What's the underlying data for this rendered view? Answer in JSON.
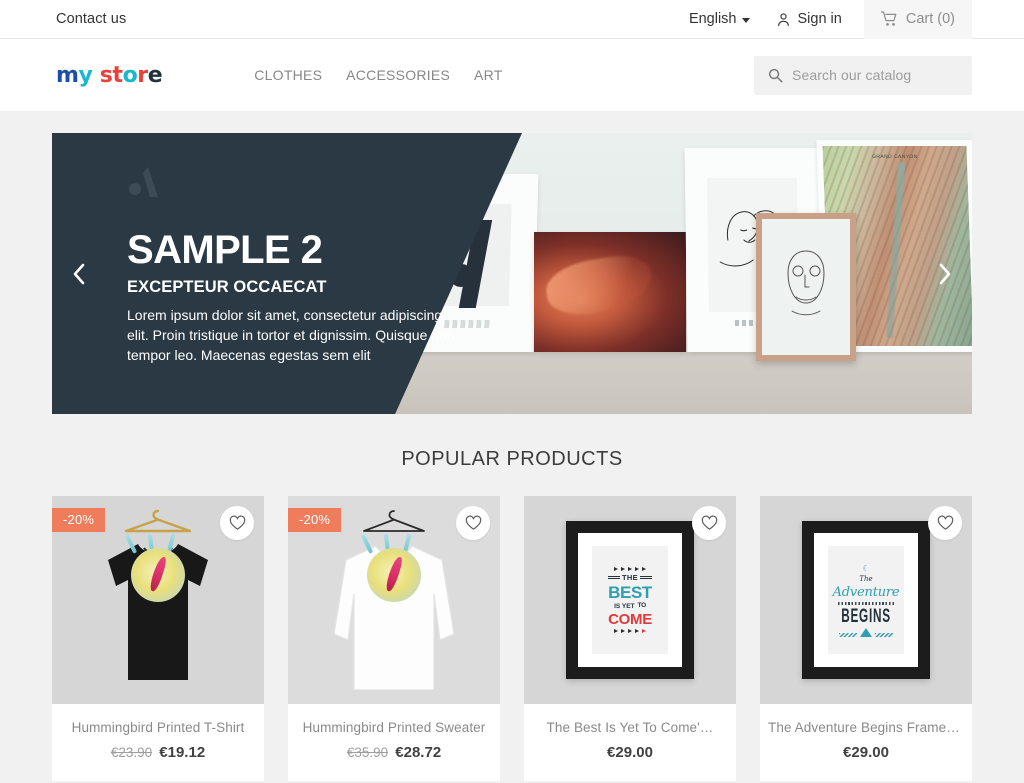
{
  "topbar": {
    "contact_label": "Contact us",
    "language_label": "English",
    "signin_label": "Sign in",
    "cart_label": "Cart (0)"
  },
  "header": {
    "logo_letters": [
      "m",
      "y",
      "s",
      "t",
      "o",
      "r",
      "e"
    ],
    "logo_text": "my store",
    "nav": [
      {
        "label": "CLOTHES"
      },
      {
        "label": "ACCESSORIES"
      },
      {
        "label": "ART"
      }
    ],
    "search": {
      "placeholder": "Search our catalog",
      "value": ""
    }
  },
  "banner": {
    "title": "SAMPLE 2",
    "subtitle": "EXCEPTEUR OCCAECAT",
    "body": "Lorem ipsum dolor sit amet, consectetur adipiscing elit. Proin tristique in tortor et dignissim. Quisque non tempor leo. Maecenas egestas sem elit",
    "prev_label": "‹",
    "next_label": "›",
    "panel_color": "#2a3944",
    "map_caption": "GRAND CANYON"
  },
  "popular": {
    "heading": "POPULAR PRODUCTS",
    "products": [
      {
        "name": "Hummingbird Printed T-Shirt",
        "badge": "-20%",
        "old_price": "€23.90",
        "price": "€19.12",
        "kind": "tshirt-black"
      },
      {
        "name": "Hummingbird Printed Sweater",
        "badge": "-20%",
        "old_price": "€35.90",
        "price": "€28.72",
        "kind": "sweater-white"
      },
      {
        "name": "The Best Is Yet To Come'…",
        "badge": "",
        "old_price": "",
        "price": "€29.00",
        "kind": "poster-best",
        "poster_lines": [
          "THE",
          "BEST",
          "IS YET",
          "TO",
          "COME"
        ]
      },
      {
        "name": "The Adventure Begins Framed…",
        "badge": "",
        "old_price": "",
        "price": "€29.00",
        "kind": "poster-adventure",
        "poster_lines": [
          "The",
          "Adventure",
          "BEGINS"
        ]
      }
    ]
  },
  "colors": {
    "badge_orange": "#ef7d5c",
    "dark_navy": "#2a3944",
    "accent_teal": "#2f9fb0",
    "accent_red": "#e03a3a",
    "page_bg": "#f1f1f1"
  }
}
